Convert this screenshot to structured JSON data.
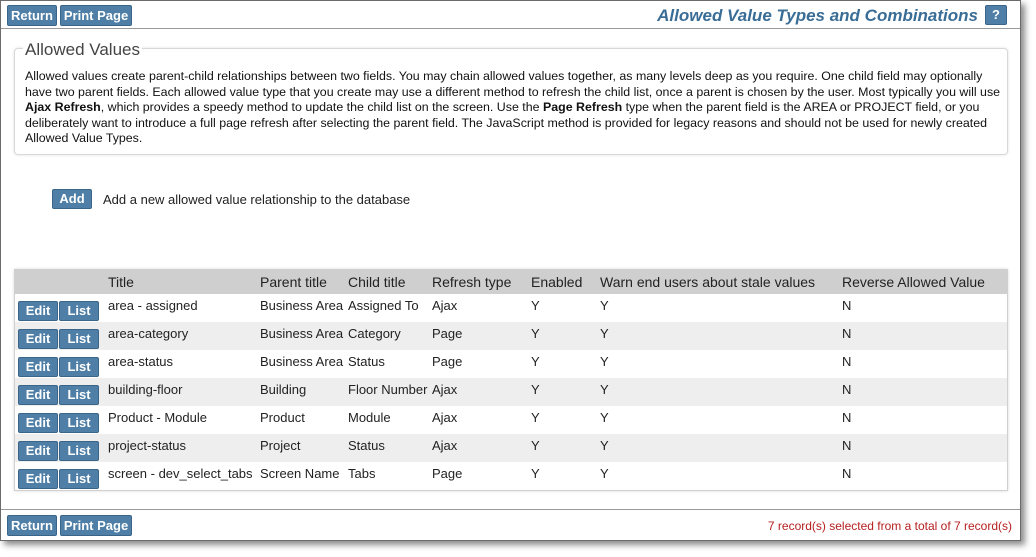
{
  "toolbar": {
    "return_label": "Return",
    "print_label": "Print Page",
    "help_label": "?"
  },
  "page_title": "Allowed Value Types and Combinations",
  "section": {
    "legend": "Allowed Values",
    "description": {
      "p1": "Allowed values create parent-child relationships between two fields. You may chain allowed values together, as many levels deep as you require. One child field may optionally have two parent fields. Each allowed value type that you create may use a different method to refresh the child list, once a parent is chosen by the user. Most typically you will use ",
      "b1": "Ajax Refresh",
      "p2": ", which provides a speedy method to update the child list on the screen. Use the ",
      "b2": "Page Refresh",
      "p3": " type when the parent field is the AREA or PROJECT field, or you deliberately want to introduce a full page refresh after selecting the parent field. The JavaScript method is provided for legacy reasons and should not be used for newly created Allowed Value Types."
    }
  },
  "add": {
    "label": "Add",
    "text": "Add a new allowed value relationship to the database"
  },
  "table": {
    "headers": {
      "title": "Title",
      "parent": "Parent title",
      "child": "Child title",
      "refresh": "Refresh type",
      "enabled": "Enabled",
      "warn": "Warn end users about stale values",
      "reverse": "Reverse Allowed Value"
    },
    "edit_label": "Edit",
    "list_label": "List",
    "rows": [
      {
        "title": "area - assigned",
        "parent": "Business Area",
        "child": "Assigned To",
        "refresh": "Ajax",
        "enabled": "Y",
        "warn": "Y",
        "reverse": "N"
      },
      {
        "title": "area-category",
        "parent": "Business Area",
        "child": "Category",
        "refresh": "Page",
        "enabled": "Y",
        "warn": "Y",
        "reverse": "N"
      },
      {
        "title": "area-status",
        "parent": "Business Area",
        "child": "Status",
        "refresh": "Page",
        "enabled": "Y",
        "warn": "Y",
        "reverse": "N"
      },
      {
        "title": "building-floor",
        "parent": "Building",
        "child": "Floor Number",
        "refresh": "Ajax",
        "enabled": "Y",
        "warn": "Y",
        "reverse": "N"
      },
      {
        "title": "Product - Module",
        "parent": "Product",
        "child": "Module",
        "refresh": "Ajax",
        "enabled": "Y",
        "warn": "Y",
        "reverse": "N"
      },
      {
        "title": "project-status",
        "parent": "Project",
        "child": "Status",
        "refresh": "Ajax",
        "enabled": "Y",
        "warn": "Y",
        "reverse": "N"
      },
      {
        "title": "screen - dev_select_tabs",
        "parent": "Screen Name",
        "child": "Tabs",
        "refresh": "Page",
        "enabled": "Y",
        "warn": "Y",
        "reverse": "N"
      }
    ]
  },
  "footer": {
    "record_count": "7 record(s) selected from a total of 7 record(s)"
  },
  "colors": {
    "button": "#4f7fa6",
    "title": "#3a6d96",
    "header_bg": "#cfcfcf",
    "row_alt": "#eeeeee",
    "record_count": "#b52020"
  }
}
